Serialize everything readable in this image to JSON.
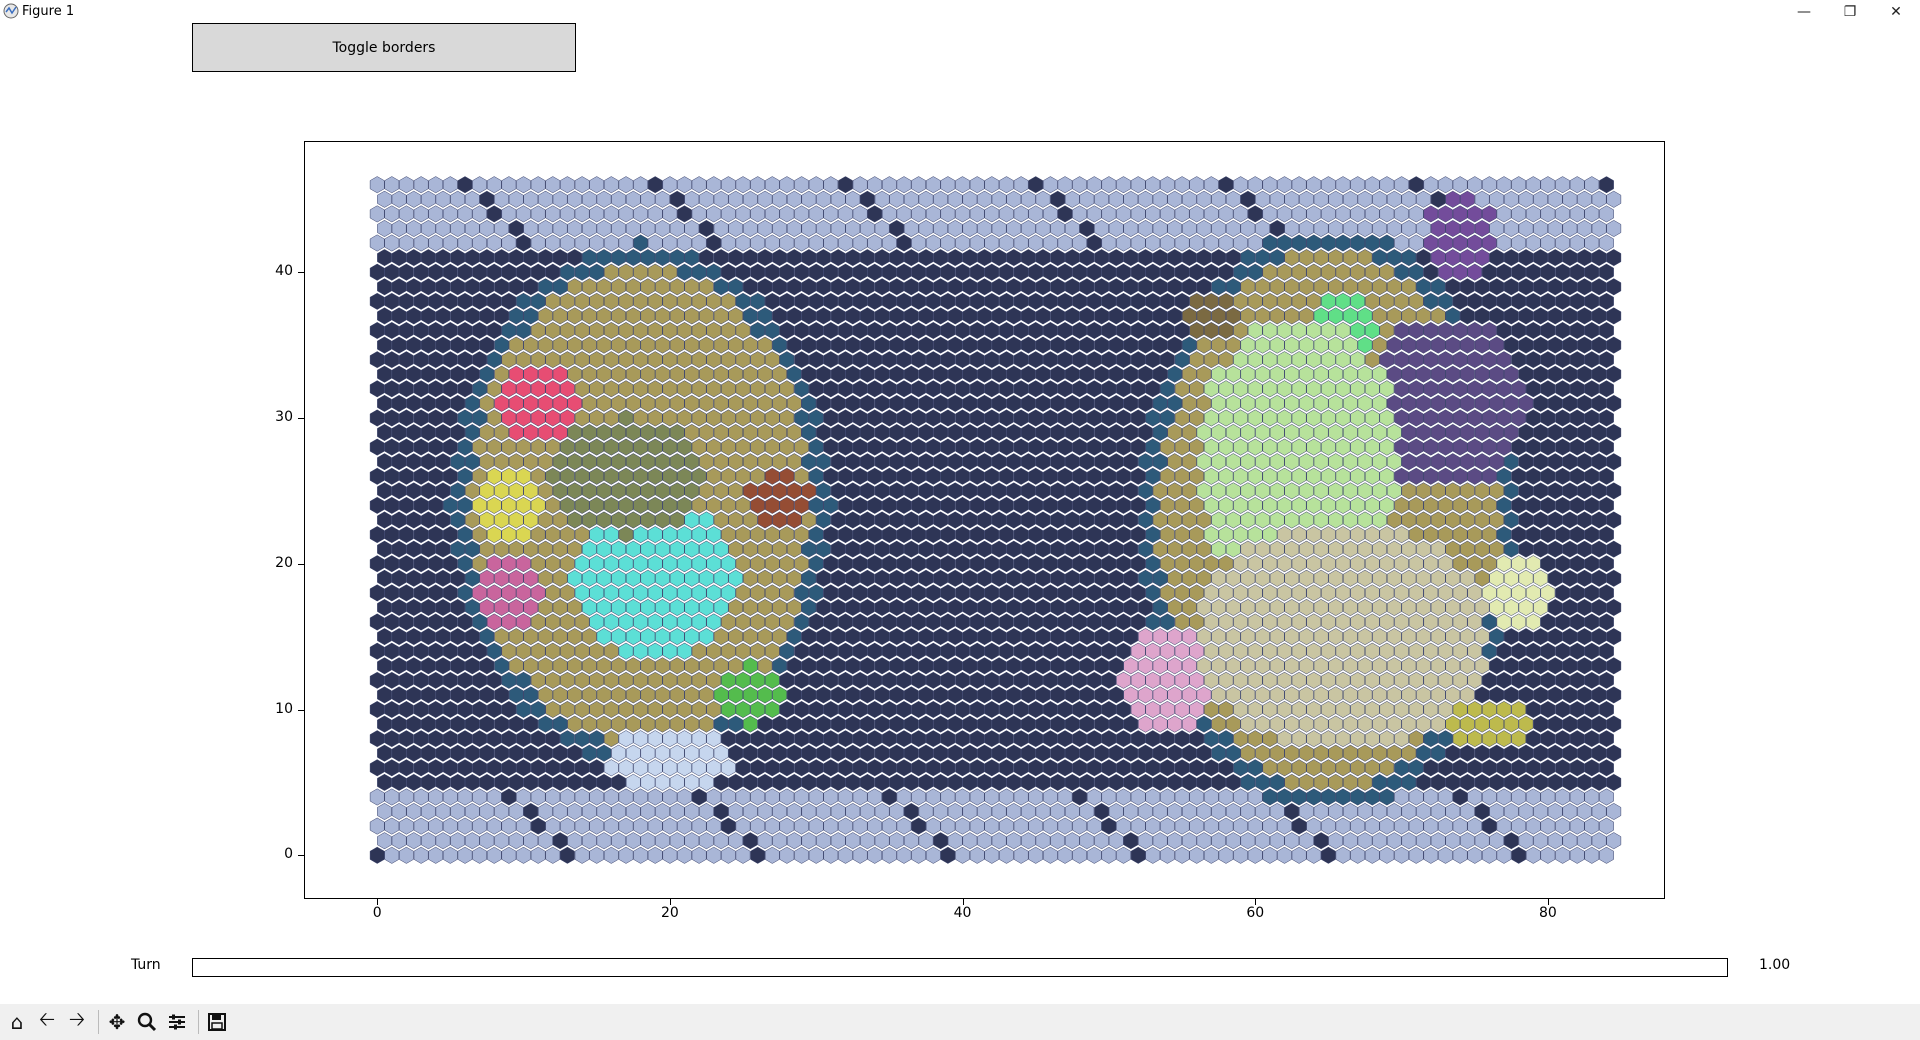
{
  "window": {
    "title": "Figure 1"
  },
  "controls": {
    "toggle_label": "Toggle borders"
  },
  "plot": {
    "y_ticks": [
      "0",
      "10",
      "20",
      "30",
      "40"
    ],
    "x_ticks": [
      "0",
      "20",
      "40",
      "60",
      "80"
    ],
    "xlim": [
      -5,
      88
    ],
    "ylim": [
      -3,
      49
    ],
    "grid_cols": 85,
    "grid_rows": 47,
    "colors": {
      "polar": "#a9b6d7",
      "ocean": "#2e3556",
      "coast": "#2d5a7a",
      "land": "#a89a5a",
      "tundra": "#c6d6ee"
    }
  },
  "slider": {
    "label": "Turn",
    "value": "1.00",
    "fraction": 0.0
  },
  "toolbar": {
    "icons": [
      "home-icon",
      "back-arrow-icon",
      "forward-arrow-icon",
      "pan-icon",
      "zoom-icon",
      "configure-icon",
      "save-icon"
    ]
  }
}
